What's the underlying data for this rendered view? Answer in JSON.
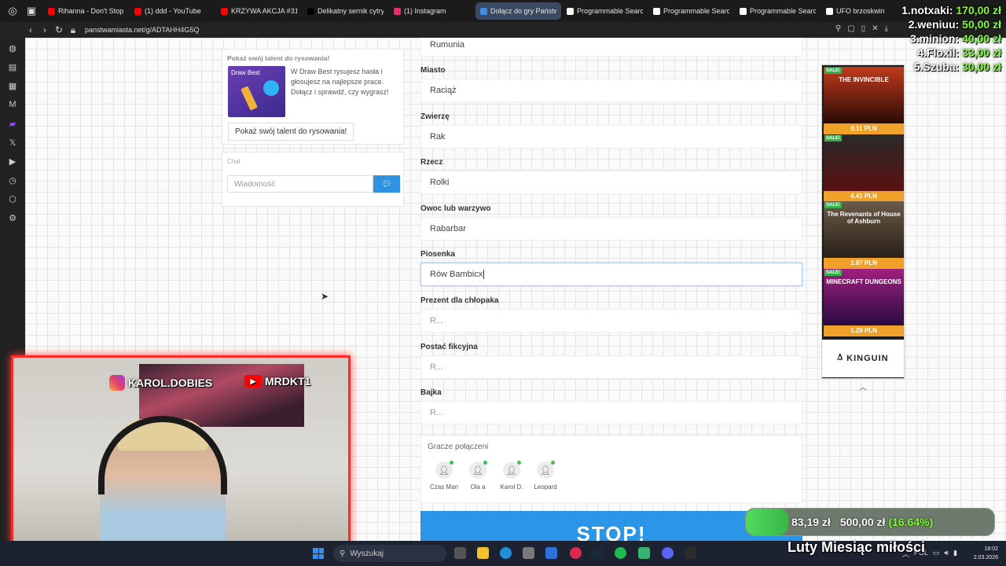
{
  "tabs": [
    {
      "label": "Rihanna - Don't Stop",
      "color": "#ff0000"
    },
    {
      "label": "(1) ddd - YouTube",
      "color": "#ff0000"
    },
    {
      "label": "KRZYWA AKCJA #31",
      "color": "#ff0000"
    },
    {
      "label": "Delikatny sernik cytry",
      "color": "#000000"
    },
    {
      "label": "(1) Instagram",
      "color": "#e1306c"
    },
    {
      "label": "Dołącz do gry Państwa M",
      "color": "#3b8eea",
      "active": true
    },
    {
      "label": "Programmable Searc",
      "color": "#ffffff"
    },
    {
      "label": "Programmable Searc",
      "color": "#ffffff"
    },
    {
      "label": "Programmable Searc",
      "color": "#ffffff"
    },
    {
      "label": "UFO brzoskwin",
      "color": "#ffffff"
    }
  ],
  "url": "panstwamiasta.net/g/ADTAHH4G5Q",
  "promo": {
    "title": "Pokaż swój talent do rysowania!",
    "image_text": "Draw Best",
    "text": "W Draw Best rysujesz hasła i głosujesz na najlepsze prace. Dołącz i sprawdź, czy wygrasz!",
    "button": "Pokaż swój talent do rysowania!"
  },
  "chat": {
    "label": "Chat",
    "placeholder": "Wiadomość",
    "send_icon": "comment-icon"
  },
  "form": {
    "top_value": "Rumunia",
    "fields": [
      {
        "label": "Miasto",
        "value": "Raciąż"
      },
      {
        "label": "Zwierzę",
        "value": "Rak"
      },
      {
        "label": "Rzecz",
        "value": "Rolki"
      },
      {
        "label": "Owoc lub warzywo",
        "value": "Rabarbar"
      },
      {
        "label": "Piosenka",
        "value": "Rów Bambicx",
        "focused": true
      },
      {
        "label": "Prezent dla chłopaka",
        "placeholder": "R..."
      },
      {
        "label": "Postać fikcyjna",
        "placeholder": "R..."
      },
      {
        "label": "Bajka",
        "placeholder": "R..."
      }
    ],
    "players_title": "Gracze połączeni",
    "players": [
      "Czas Man",
      "Ola a",
      "Karol D.",
      "Leopard"
    ],
    "stop_button": "STOP!"
  },
  "ad": {
    "sale_badge": "SALE!",
    "games": [
      {
        "title": "THE INVINCIBLE",
        "price": "8.11 PLN",
        "colors": [
          "#c23a1c",
          "#2a0b05"
        ]
      },
      {
        "title": "",
        "price": "4.41 PLN",
        "colors": [
          "#2a2a2a",
          "#5a1010"
        ]
      },
      {
        "title": "The Revenants of House of Ashburn",
        "price": "1.87 PLN",
        "colors": [
          "#6b5a48",
          "#2a2018"
        ]
      },
      {
        "title": "MINECRAFT DUNGEONS",
        "price": "1.29 PLN",
        "colors": [
          "#a02080",
          "#2a0a40"
        ]
      }
    ],
    "brand": "KINGUIN"
  },
  "stream": {
    "instagram": "KAROL.DOBIES",
    "youtube": "MRDKT1",
    "leaderboard": [
      {
        "name": "1.notxaki:",
        "amount": "170,00 zł"
      },
      {
        "name": "2.weniuu:",
        "amount": "50,00 zł"
      },
      {
        "name": "3.minion:",
        "amount": "40,00 zł"
      },
      {
        "name": "4.Floxil:",
        "amount": "33,00 zł"
      },
      {
        "name": "5.Szuba:",
        "amount": "30,00 zł"
      }
    ],
    "goal": {
      "current": "83,19 zł",
      "target": "500,00 zł",
      "percent": "(16.64%)",
      "progress": 0.1664
    },
    "goal_title": "Luty Miesiąc miłości"
  },
  "taskbar": {
    "search": "Wyszukaj",
    "lang": "POL",
    "time": "18:02",
    "date": "2.03.2026"
  }
}
